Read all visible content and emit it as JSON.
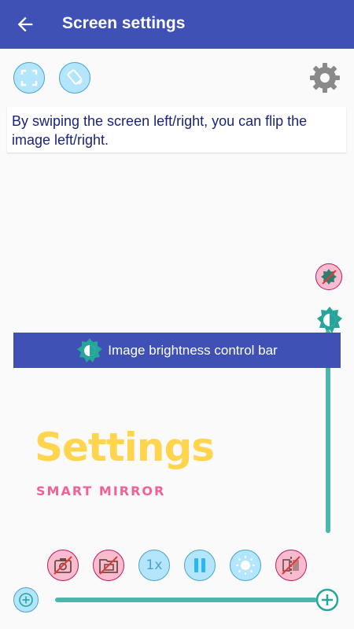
{
  "appbar": {
    "title": "Screen settings",
    "back_icon": "arrow-back-icon"
  },
  "top_tools": {
    "fullscreen_icon": "fullscreen-icon",
    "rotate_icon": "screen-rotation-icon",
    "settings_icon": "gear-icon"
  },
  "info": {
    "text": "By swiping the screen left/right, you can flip the image left/right."
  },
  "brightness_bar": {
    "label": "Image brightness control bar",
    "icon": "brightness-icon"
  },
  "brightness": {
    "level": 1.0
  },
  "logo": {
    "title": "Settings",
    "subtitle": "SMART MIRROR"
  },
  "bottom_tools": {
    "camera_off_icon": "camera-off-icon",
    "gallery_off_icon": "gallery-off-icon",
    "zoom_label": "1x",
    "pause_icon": "pause-icon",
    "light_icon": "sun-icon",
    "flip_off_icon": "flip-off-icon"
  },
  "zoom_slider": {
    "level": 1.0,
    "minus_icon": "zoom-out-icon",
    "plus_icon": "zoom-in-icon"
  },
  "colors": {
    "primary": "#3f51b5",
    "accent_teal": "#4db6ac",
    "logo_yellow": "#ffd54f",
    "logo_pink": "#f06292",
    "disabled_pink": "#f8bbd0",
    "button_blue": "#b3e5fc"
  }
}
